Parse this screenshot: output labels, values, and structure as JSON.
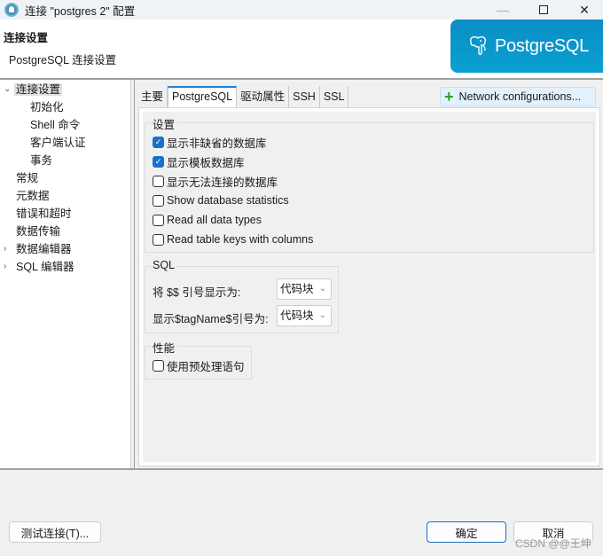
{
  "window": {
    "title": "连接 \"postgres 2\" 配置",
    "controls": {
      "minimize": "—",
      "close": "✕"
    }
  },
  "header": {
    "title": "连接设置",
    "subtitle": "PostgreSQL 连接设置",
    "logo_text": "PostgreSQL",
    "logo_color": "#0a9bcf"
  },
  "tree": {
    "items": [
      {
        "label": "连接设置",
        "chevron": "⌄",
        "expanded": true,
        "selected": true
      },
      {
        "label": "初始化"
      },
      {
        "label": "Shell 命令"
      },
      {
        "label": "客户端认证"
      },
      {
        "label": "事务"
      },
      {
        "label": "常规"
      },
      {
        "label": "元数据"
      },
      {
        "label": "错误和超时"
      },
      {
        "label": "数据传输"
      },
      {
        "label": "数据编辑器",
        "chevron": "›",
        "expanded": false
      },
      {
        "label": "SQL 编辑器",
        "chevron": "›",
        "expanded": false
      }
    ]
  },
  "tabs": [
    {
      "label": "主要",
      "active": false
    },
    {
      "label": "PostgreSQL",
      "active": true
    },
    {
      "label": "驱动属性",
      "active": false
    },
    {
      "label": "SSH",
      "active": false
    },
    {
      "label": "SSL",
      "active": false
    }
  ],
  "network_button": {
    "icon": "+",
    "label": "Network configurations..."
  },
  "settings_group": {
    "title": "设置",
    "checkboxes": [
      {
        "label": "显示非缺省的数据库",
        "checked": true
      },
      {
        "label": "显示模板数据库",
        "checked": true
      },
      {
        "label": "显示无法连接的数据库",
        "checked": false
      },
      {
        "label": "Show database statistics",
        "checked": false
      },
      {
        "label": "Read all data types",
        "checked": false
      },
      {
        "label": "Read table keys with columns",
        "checked": false
      }
    ],
    "check_mark": "✓"
  },
  "sql_group": {
    "title": "SQL",
    "fields": [
      {
        "label": "将 $$ 引号显示为:",
        "value": "代码块"
      },
      {
        "label": "显示$tagName$引号为:",
        "value": "代码块"
      }
    ],
    "chevron": "⌄"
  },
  "perf_group": {
    "title": "性能",
    "checkbox": {
      "label": "使用预处理语句",
      "checked": false
    }
  },
  "buttons": {
    "test": "测试连接(T)...",
    "ok": "确定",
    "cancel": "取消"
  },
  "watermark": "CSDN @@王坤"
}
